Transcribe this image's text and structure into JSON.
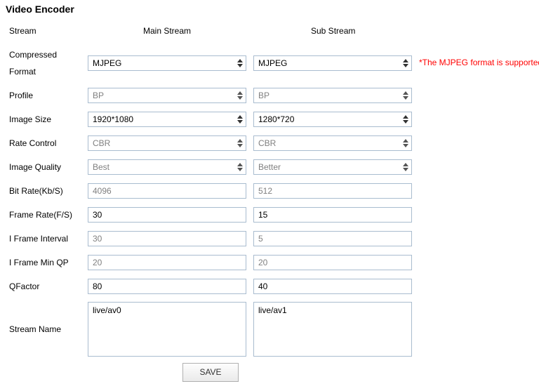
{
  "title": "Video Encoder",
  "headers": {
    "stream": "Stream",
    "main": "Main Stream",
    "sub": "Sub Stream"
  },
  "rows": {
    "format": {
      "label_line1": "Compressed",
      "label_line2": "Format",
      "main": "MJPEG",
      "sub": "MJPEG"
    },
    "profile": {
      "label": "Profile",
      "main": "BP",
      "sub": "BP"
    },
    "size": {
      "label": "Image Size",
      "main": "1920*1080",
      "sub": "1280*720"
    },
    "rate_ctrl": {
      "label": "Rate Control",
      "main": "CBR",
      "sub": "CBR"
    },
    "quality": {
      "label": "Image Quality",
      "main": "Best",
      "sub": "Better"
    },
    "bitrate": {
      "label": "Bit Rate(Kb/S)",
      "main": "4096",
      "sub": "512"
    },
    "framerate": {
      "label": "Frame Rate(F/S)",
      "main": "30",
      "sub": "15"
    },
    "iframe": {
      "label": "I Frame Interval",
      "main": "30",
      "sub": "5"
    },
    "minqp": {
      "label": "I Frame Min QP",
      "main": "20",
      "sub": "20"
    },
    "qfactor": {
      "label": "QFactor",
      "main": "80",
      "sub": "40"
    },
    "name": {
      "label": "Stream Name",
      "main": "live/av0",
      "sub": "live/av1"
    }
  },
  "note": "*The MJPEG format is supported",
  "save_label": "SAVE"
}
